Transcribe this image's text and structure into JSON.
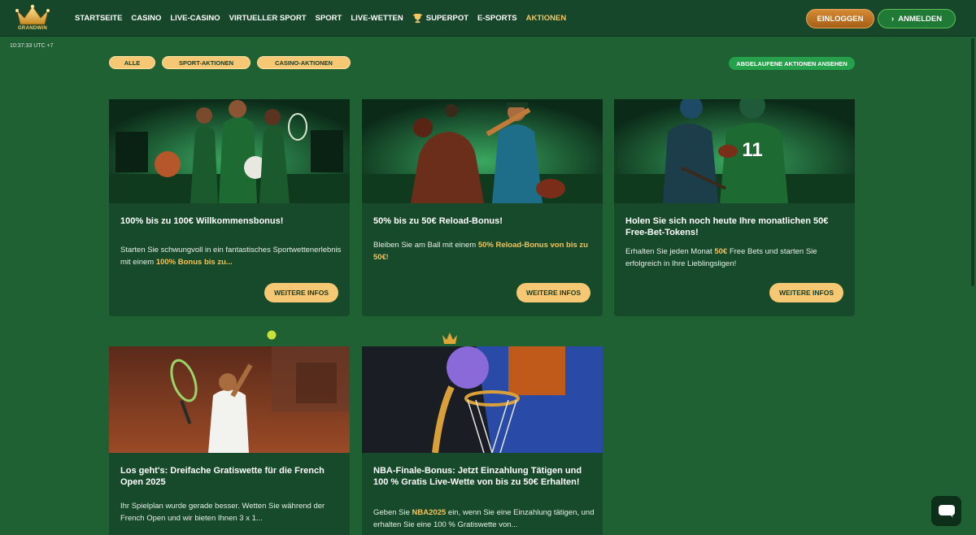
{
  "brand": {
    "logo_text": "GRANDWIN",
    "accent": "#f2c764",
    "bg": "#1f6133"
  },
  "nav": {
    "items": [
      {
        "label": "STARTSEITE"
      },
      {
        "label": "CASINO"
      },
      {
        "label": "LIVE-CASINO"
      },
      {
        "label": "VIRTUELLER SPORT"
      },
      {
        "label": "SPORT"
      },
      {
        "label": "LIVE-WETTEN"
      },
      {
        "label": "SUPERPOT",
        "icon": "trophy-icon"
      },
      {
        "label": "E-SPORTS"
      },
      {
        "label": "AKTIONEN",
        "active": true
      }
    ],
    "login_label": "EINLOGGEN",
    "register_label": "ANMELDEN"
  },
  "clock": "10:37:33 UTC +7",
  "filters": {
    "all": "ALLE",
    "sport": "SPORT-AKTIONEN",
    "casino": "CASINO-AKTIONEN",
    "expired": "ABGELAUFENE AKTIONEN ANSEHEN"
  },
  "cards": [
    {
      "title": "100% bis zu 100€ Willkommensbonus!",
      "desc_a": "Starten Sie schwungvoll in ein fantastisches Sportwettenerlebnis mit einem ",
      "desc_hl": "100% Bonus bis zu...",
      "desc_b": "",
      "button": "WEITERE INFOS"
    },
    {
      "title": "50% bis zu 50€ Reload-Bonus!",
      "desc_a": "Bleiben Sie am Ball mit einem ",
      "desc_hl": "50% Reload-Bonus von bis zu 50€",
      "desc_b": "!",
      "button": "WEITERE INFOS"
    },
    {
      "title": "Holen Sie sich noch heute Ihre monatlichen 50€ Free-Bet-Tokens!",
      "desc_a": "Erhalten Sie jeden Monat ",
      "desc_hl": "50€",
      "desc_b": " Free Bets und starten Sie erfolgreich in Ihre Lieblingsligen!",
      "button": "WEITERE INFOS"
    },
    {
      "title": "Los geht's: Dreifache Gratiswette für die French Open 2025",
      "desc_a": "Ihr Spielplan wurde gerade besser. Wetten Sie während der French Open und wir bieten Ihnen 3 x 1...",
      "desc_hl": "",
      "desc_b": ""
    },
    {
      "title": "NBA-Finale-Bonus: Jetzt Einzahlung Tätigen und 100 % Gratis Live-Wette von bis zu 50€ Erhalten!",
      "desc_a": "Geben Sie ",
      "desc_hl": "NBA2025",
      "desc_b": " ein, wenn Sie eine Einzahlung tätigen, und erhalten Sie eine 100 % Gratiswette von...",
      "button": ""
    }
  ]
}
